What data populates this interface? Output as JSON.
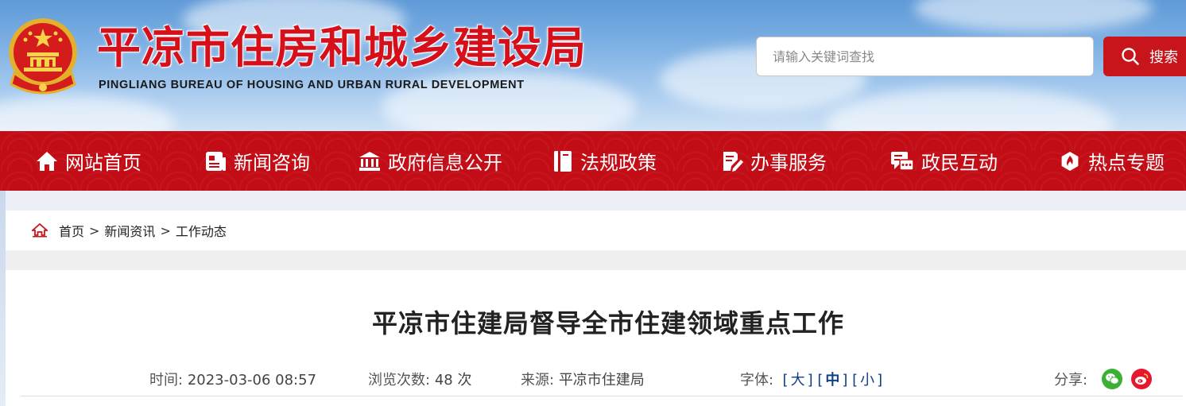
{
  "header": {
    "title": "平凉市住房和城乡建设局",
    "subtitle": "PINGLIANG BUREAU OF HOUSING AND URBAN RURAL DEVELOPMENT",
    "search_placeholder": "请输入关键词查找",
    "search_button": "搜索",
    "emblem_icon": "national-emblem-icon"
  },
  "nav": {
    "items": [
      {
        "label": "网站首页",
        "icon": "home-icon"
      },
      {
        "label": "新闻咨询",
        "icon": "news-icon"
      },
      {
        "label": "政府信息公开",
        "icon": "government-building-icon"
      },
      {
        "label": "法规政策",
        "icon": "book-icon"
      },
      {
        "label": "办事服务",
        "icon": "edit-document-icon"
      },
      {
        "label": "政民互动",
        "icon": "chat-icon"
      },
      {
        "label": "热点专题",
        "icon": "hotspot-icon"
      }
    ]
  },
  "breadcrumb": {
    "items": [
      "首页",
      "新闻资讯",
      "工作动态"
    ],
    "separator": ">"
  },
  "article": {
    "title": "平凉市住建局督导全市住建领域重点工作",
    "time_label": "时间:",
    "time_value": "2023-03-06 08:57",
    "views_label": "浏览次数:",
    "views_value": "48 次",
    "source_label": "来源:",
    "source_value": "平凉市住建局",
    "font_label": "字体:",
    "font_sizes": [
      "大",
      "中",
      "小"
    ],
    "font_selected": "中",
    "share_label": "分享:"
  },
  "colors": {
    "brand_red": "#c30d16",
    "title_red": "#d6101a",
    "link_blue": "#0e3f87",
    "wechat_green": "#3cb034",
    "weibo_red": "#e6162d"
  }
}
